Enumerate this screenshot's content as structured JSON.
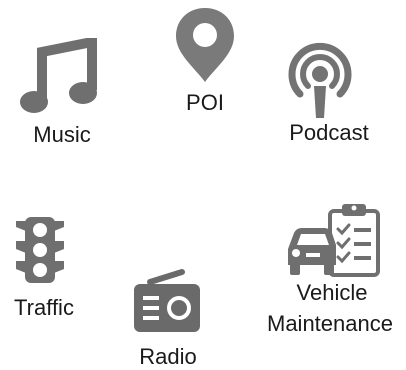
{
  "tiles": {
    "music": {
      "label": "Music",
      "icon": "music-note-icon"
    },
    "poi": {
      "label": "POI",
      "icon": "map-pin-icon"
    },
    "podcast": {
      "label": "Podcast",
      "icon": "podcast-icon"
    },
    "traffic": {
      "label": "Traffic",
      "icon": "traffic-light-icon"
    },
    "radio": {
      "label": "Radio",
      "icon": "radio-icon"
    },
    "vehicle_maintenance": {
      "label_line1": "Vehicle",
      "label_line2": "Maintenance",
      "icon": "vehicle-checklist-icon"
    }
  },
  "colors": {
    "icon_dark": "#6f6f6f",
    "icon_mid": "#8a8a8a",
    "text": "#1a1a1a",
    "background": "#ffffff"
  }
}
